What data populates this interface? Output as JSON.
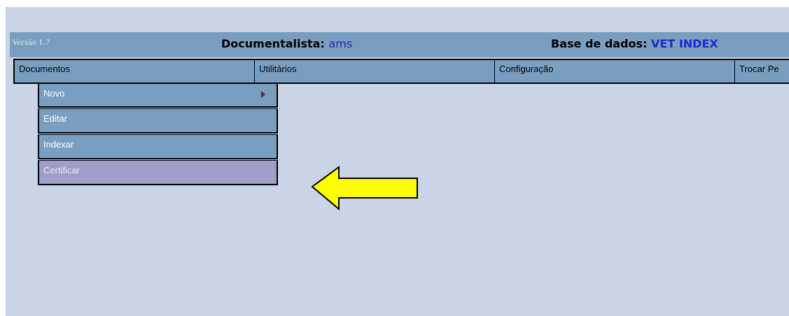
{
  "header": {
    "version": "Versão 1.7",
    "documentalista_label": "Documentalista:",
    "documentalista_user": "ams",
    "database_label": "Base de dados:",
    "database_name": "VET INDEX"
  },
  "menubar": {
    "items": [
      {
        "label": "Documentos"
      },
      {
        "label": "Utilitários"
      },
      {
        "label": "Configuração"
      },
      {
        "label": "Trocar Pe"
      }
    ]
  },
  "submenu": {
    "items": [
      {
        "label": "Novo",
        "has_submenu": true
      },
      {
        "label": "Editar"
      },
      {
        "label": "Indexar"
      },
      {
        "label": "Certificar",
        "highlighted": true
      }
    ]
  },
  "colors": {
    "background": "#c9d5e6",
    "bar": "#7a9ec0",
    "highlight": "#a09ec9",
    "arrow": "#ffff00"
  }
}
